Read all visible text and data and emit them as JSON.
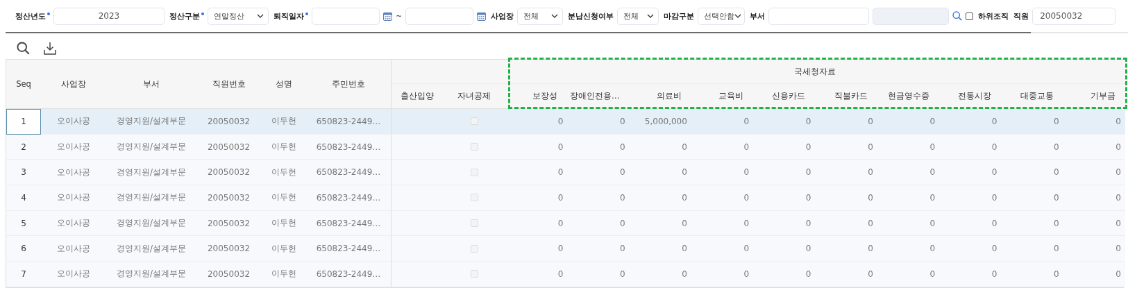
{
  "filters": [
    {
      "kind": "year",
      "label": "정산년도",
      "required": true,
      "value": "2023"
    },
    {
      "kind": "select",
      "label": "정산구분",
      "required": true,
      "value": "연말정산"
    },
    {
      "kind": "daterange",
      "label": "퇴직일자",
      "required": true,
      "separator": "~"
    },
    {
      "kind": "select",
      "label": "사업장",
      "required": false,
      "value": "전체"
    },
    {
      "kind": "select",
      "label": "분납신청여부",
      "required": false,
      "value": "전체"
    },
    {
      "kind": "select",
      "label": "마감구분",
      "required": false,
      "value": "선택안함"
    },
    {
      "kind": "dept",
      "label": "부서",
      "required": false,
      "include_sub": {
        "label": "하위조직",
        "checked": false
      }
    },
    {
      "kind": "input",
      "label": "직원",
      "required": false,
      "value": "20050032"
    }
  ],
  "table": {
    "columns": [
      "Seq",
      "사업장",
      "부서",
      "직원번호",
      "성명",
      "주민번호"
    ],
    "extra_columns": [
      "출산입양",
      "자녀공제"
    ],
    "group": {
      "title": "국세청자료",
      "highlighted": true,
      "columns": [
        "보장성",
        "장애인전용…",
        "의료비",
        "교육비",
        "신용카드",
        "직불카드",
        "현금영수증",
        "전통시장",
        "대중교통",
        "기부금"
      ]
    },
    "rows": [
      {
        "seq": "1",
        "selected": true,
        "site": "오이사공",
        "dept": "경영지원/설계부문",
        "emp_no": "20050032",
        "name": "이두헌",
        "rrn": "650823-2449…",
        "child_deduction": false,
        "values": [
          "0",
          "0",
          "5,000,000",
          "0",
          "0",
          "0",
          "0",
          "0",
          "0",
          "0"
        ]
      },
      {
        "seq": "2",
        "selected": false,
        "site": "오이사공",
        "dept": "경영지원/설계부문",
        "emp_no": "20050032",
        "name": "이두헌",
        "rrn": "650823-2449…",
        "child_deduction": false,
        "values": [
          "0",
          "0",
          "0",
          "0",
          "0",
          "0",
          "0",
          "0",
          "0",
          "0"
        ]
      },
      {
        "seq": "3",
        "selected": false,
        "site": "오이사공",
        "dept": "경영지원/설계부문",
        "emp_no": "20050032",
        "name": "이두헌",
        "rrn": "650823-2449…",
        "child_deduction": false,
        "values": [
          "0",
          "0",
          "0",
          "0",
          "0",
          "0",
          "0",
          "0",
          "0",
          "0"
        ]
      },
      {
        "seq": "4",
        "selected": false,
        "site": "오이사공",
        "dept": "경영지원/설계부문",
        "emp_no": "20050032",
        "name": "이두헌",
        "rrn": "650823-2449…",
        "child_deduction": false,
        "values": [
          "0",
          "0",
          "0",
          "0",
          "0",
          "0",
          "0",
          "0",
          "0",
          "0"
        ]
      },
      {
        "seq": "5",
        "selected": false,
        "site": "오이사공",
        "dept": "경영지원/설계부문",
        "emp_no": "20050032",
        "name": "이두헌",
        "rrn": "650823-2449…",
        "child_deduction": false,
        "values": [
          "0",
          "0",
          "0",
          "0",
          "0",
          "0",
          "0",
          "0",
          "0",
          "0"
        ]
      },
      {
        "seq": "6",
        "selected": false,
        "site": "오이사공",
        "dept": "경영지원/설계부문",
        "emp_no": "20050032",
        "name": "이두헌",
        "rrn": "650823-2449…",
        "child_deduction": false,
        "values": [
          "0",
          "0",
          "0",
          "0",
          "0",
          "0",
          "0",
          "0",
          "0",
          "0"
        ]
      },
      {
        "seq": "7",
        "selected": false,
        "site": "오이사공",
        "dept": "경영지원/설계부문",
        "emp_no": "20050032",
        "name": "이두헌",
        "rrn": "650823-2449…",
        "child_deduction": false,
        "values": [
          "0",
          "0",
          "0",
          "0",
          "0",
          "0",
          "0",
          "0",
          "0",
          "0"
        ]
      }
    ]
  }
}
